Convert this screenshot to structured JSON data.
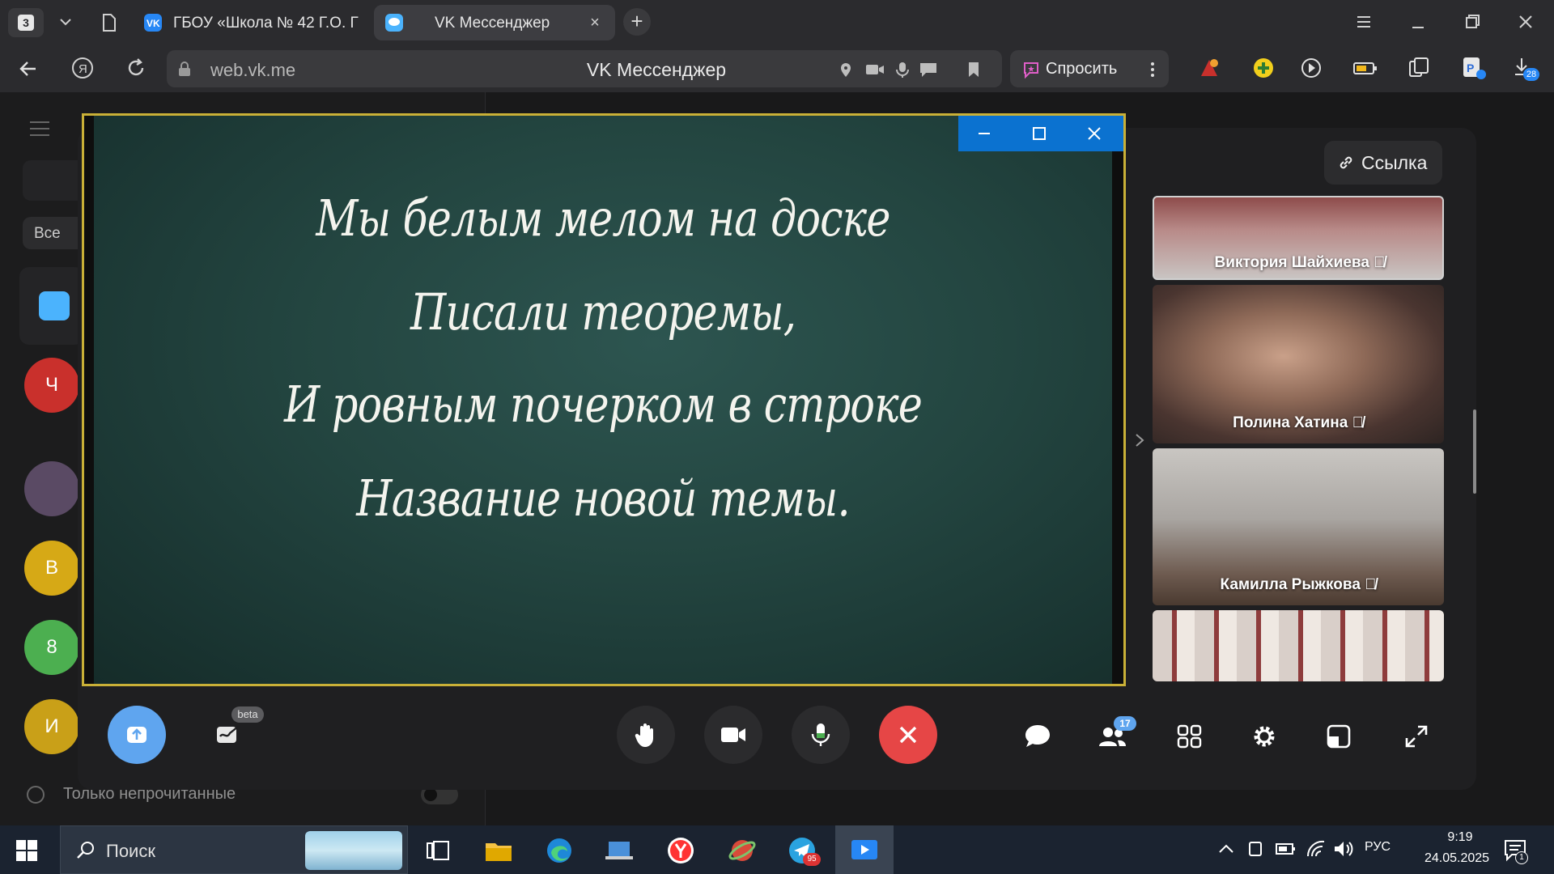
{
  "browser": {
    "tab_count": "3",
    "tabs": [
      {
        "title": "ГБОУ «Школа № 42 Г.О. Г",
        "active": false
      },
      {
        "title": "VK Мессенджер",
        "active": true
      }
    ],
    "url": "web.vk.me",
    "page_title": "VK Мессенджер",
    "ask_label": "Спросить",
    "downloads_badge": "28"
  },
  "sidebar": {
    "filter_chip": "Все",
    "avatars": [
      {
        "letter": "Ч",
        "color": "#c9302c"
      },
      {
        "letter": "В",
        "color": "#d6a916"
      },
      {
        "letter": "8",
        "color": "#4caf50"
      },
      {
        "letter": "И",
        "color": "#c9a018"
      }
    ],
    "unread_only_label": "Только непрочитанные"
  },
  "call": {
    "link_button": "Ссылка",
    "presentation_lines": [
      "Мы белым мелом на доске",
      "Писали теоремы,",
      "И ровным почерком в строке",
      "Название новой темы."
    ],
    "participants": [
      {
        "name": "Виктория Шайхиева",
        "muted": true
      },
      {
        "name": "Полина Хатина",
        "muted": true
      },
      {
        "name": "Камилла Рыжкова",
        "muted": true
      },
      {
        "name": "",
        "muted": false
      }
    ],
    "beta_badge": "beta",
    "participants_count": "17"
  },
  "taskbar": {
    "search_label": "Поиск",
    "telegram_badge": "95",
    "language": "РУС",
    "time": "9:19",
    "date": "24.05.2025",
    "notifications": "1"
  }
}
